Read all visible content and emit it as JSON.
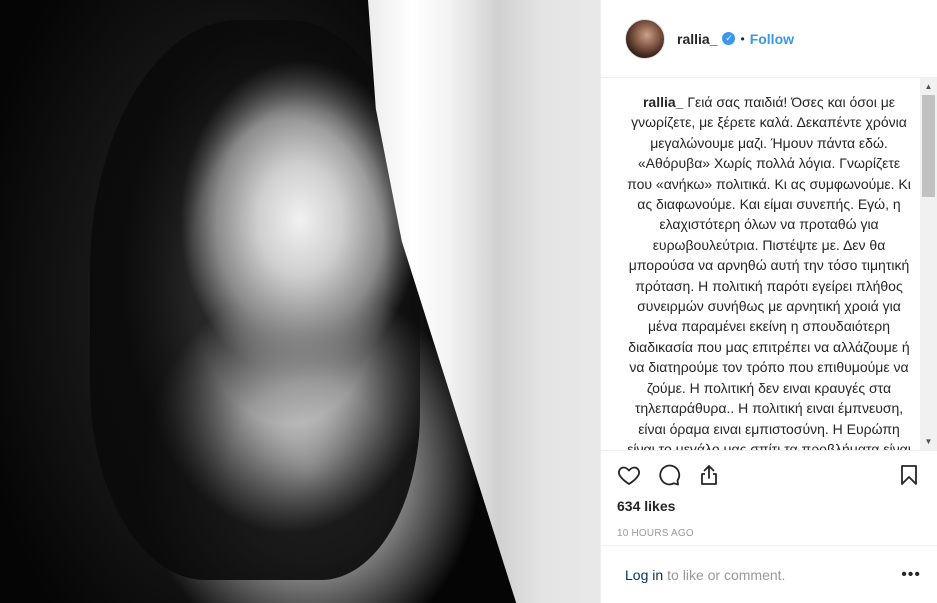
{
  "post": {
    "photo_alt": "",
    "user": {
      "username": "rallia_",
      "verified_icon": "verified-badge-icon",
      "separator": "•",
      "follow_label": "Follow"
    },
    "caption": {
      "username": "rallia_",
      "text": "Γειά σας παιδιά! Όσες και όσοι με γνωρίζετε, με ξέρετε καλά. Δεκαπέντε χρόνια μεγαλώνουμε μαζι. Ήμουν πάντα εδώ. «Αθόρυβα» Χωρίς πολλά λόγια. Γνωρίζετε που «ανήκω» πολιτικά. Κι ας συμφωνούμε. Κι ας διαφωνούμε. Και είμαι συνεπής. Εγώ, η ελαχιστότερη όλων να προταθώ για ευρωβουλεύτρια. Πιστέψτε με. Δεν θα μπορούσα να αρνηθώ αυτή την τόσο τιμητική πρόταση. Η πολιτική παρότι εγείρει πλήθος συνειρμών συνήθως με αρνητική χροιά για μένα παραμένει εκείνη η σπουδαιότερη διαδικασία που μας επιτρέπει να αλλάζουμε ή να διατηρούμε τον τρόπο που επιθυμούμε να ζούμε. Η πολιτική δεν ειναι κραυγές στα τηλεπαράθυρα.. Η πολιτική ειναι έμπνευση, είναι όραμα ειναι εμπιστοσύνη. Η Ευρώπη είναι το μεγάλο μας σπίτι τα προβλήματα είναι κοινά και"
    },
    "actions": {
      "like_icon": "heart-icon",
      "comment_icon": "comment-icon",
      "share_icon": "share-icon",
      "save_icon": "bookmark-icon",
      "likes": "634 likes",
      "timestamp": "10 HOURS AGO"
    },
    "comment": {
      "login_label": "Log in",
      "rest": "to like or comment.",
      "more_label": "•••"
    }
  },
  "colors": {
    "link_blue": "#3897f0",
    "login_navy": "#003569",
    "muted": "#999999",
    "text": "#262626"
  }
}
